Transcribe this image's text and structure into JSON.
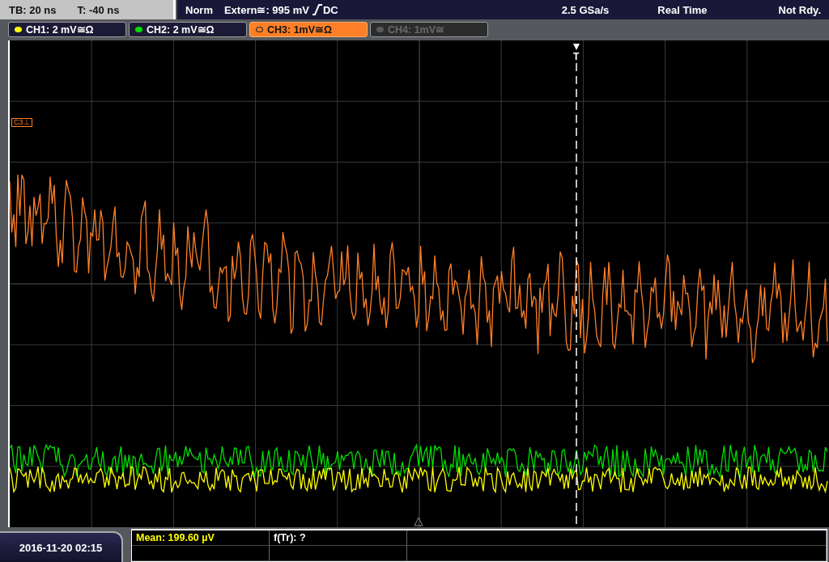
{
  "timebase": {
    "tb": "TB: 20 ns",
    "t": "T: -40 ns"
  },
  "status_bar": {
    "mode": "Norm",
    "trigger_source": "Extern≅: 995 mV",
    "coupling": "DC",
    "sample_rate": "2.5 GSa/s",
    "acquisition": "Real Time",
    "state": "Not Rdy."
  },
  "channels": [
    {
      "label": "CH1: 2 mV≅Ω",
      "color": "#ffff00",
      "selected": false,
      "disabled": false,
      "kind": "noise-low"
    },
    {
      "label": "CH2: 2 mV≅Ω",
      "color": "#00e000",
      "selected": false,
      "disabled": false,
      "kind": "noise-high"
    },
    {
      "label": "CH3: 1mV≅Ω",
      "color": "#ff7f27",
      "selected": true,
      "disabled": false,
      "kind": "decay",
      "marker": "C3⊥"
    },
    {
      "label": "CH4: 1mV≅",
      "color": "#5a5a5a",
      "selected": false,
      "disabled": true,
      "kind": "none"
    }
  ],
  "trigger_marker": "T",
  "date": "2016-11-20 02:15",
  "measurements": [
    {
      "text": "Mean: 199.60 µV",
      "color": "#ffff00"
    },
    {
      "text": "f(Tr): ?",
      "color": "#ffffff"
    }
  ]
}
